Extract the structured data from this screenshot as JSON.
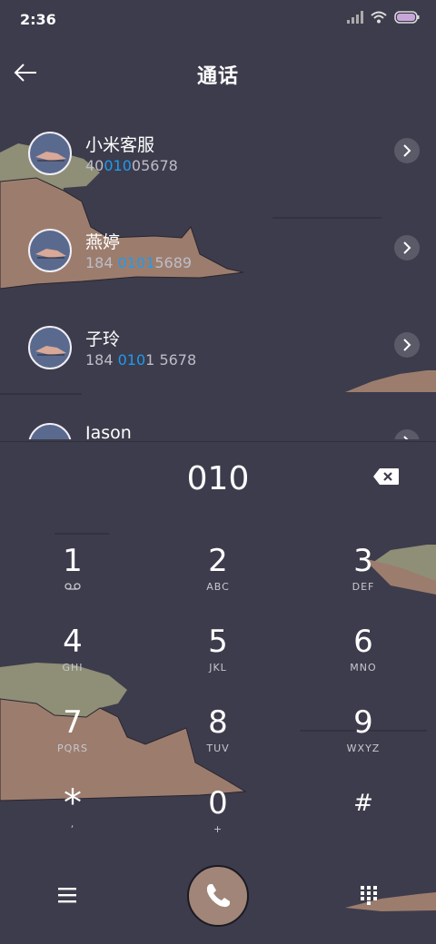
{
  "status_bar": {
    "time": "2:36"
  },
  "header": {
    "title": "通话"
  },
  "contacts": [
    {
      "name": "小米客服",
      "number_pre": "40",
      "number_hl": "010",
      "number_post": "05678"
    },
    {
      "name": "燕婷",
      "number_pre": "184 ",
      "number_hl": "0101",
      "number_post": "5689"
    },
    {
      "name": "子玲",
      "number_pre": "184 ",
      "number_hl": "010",
      "number_post": "1 5678"
    },
    {
      "name": "Jason",
      "number_pre": "",
      "number_hl": "",
      "number_post": ""
    }
  ],
  "dialer": {
    "input": "010"
  },
  "keypad": [
    {
      "digit": "1",
      "letters": ""
    },
    {
      "digit": "2",
      "letters": "ABC"
    },
    {
      "digit": "3",
      "letters": "DEF"
    },
    {
      "digit": "4",
      "letters": "GHI"
    },
    {
      "digit": "5",
      "letters": "JKL"
    },
    {
      "digit": "6",
      "letters": "MNO"
    },
    {
      "digit": "7",
      "letters": "PQRS"
    },
    {
      "digit": "8",
      "letters": "TUV"
    },
    {
      "digit": "9",
      "letters": "WXYZ"
    },
    {
      "digit": "*",
      "letters": ","
    },
    {
      "digit": "0",
      "letters": "+"
    },
    {
      "digit": "#",
      "letters": ""
    }
  ],
  "icons": {
    "back": "back-arrow-icon",
    "chevron": "chevron-right-icon",
    "delete": "backspace-icon",
    "voicemail": "voicemail-icon",
    "menu": "menu-icon",
    "call": "phone-icon",
    "dialpad": "dialpad-icon"
  },
  "colors": {
    "background": "#3d3c4c",
    "highlight": "#1e9bf0",
    "call_button": "#a08578"
  }
}
